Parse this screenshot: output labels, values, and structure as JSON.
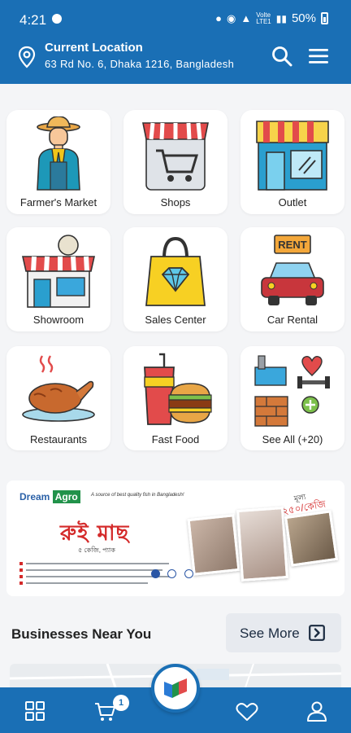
{
  "status": {
    "time": "4:21",
    "network": [
      "Volte",
      "LTE1"
    ],
    "battery": "50%"
  },
  "location": {
    "title": "Current Location",
    "address": "63 Rd No. 6, Dhaka 1216, Bangladesh"
  },
  "header_icons": [
    "search-icon",
    "menu-icon"
  ],
  "categories": [
    {
      "label": "Farmer's Market",
      "icon": "farmer-icon"
    },
    {
      "label": "Shops",
      "icon": "shopping-cart-icon"
    },
    {
      "label": "Outlet",
      "icon": "outlet-store-icon"
    },
    {
      "label": "Showroom",
      "icon": "showroom-icon"
    },
    {
      "label": "Sales Center",
      "icon": "shopping-bag-diamond-icon"
    },
    {
      "label": "Car Rental",
      "icon": "car-rent-icon"
    },
    {
      "label": "Restaurants",
      "icon": "roast-chicken-icon"
    },
    {
      "label": "Fast Food",
      "icon": "burger-drink-icon"
    },
    {
      "label": "See All (+20)",
      "icon": "more-categories-icon"
    }
  ],
  "banner": {
    "brand_a": "Dream",
    "brand_b": "Agro",
    "tagline": "A source of best quality fish in Bangladesh!",
    "title": "রুই মাছ",
    "subtitle": "৫ কেজি, প্যাক",
    "price_label": "মূল্য",
    "price": "৳ ২৫০/কেজি",
    "pages": 3,
    "active_page": 1
  },
  "section": {
    "title": "Businesses Near You",
    "see_more": "See More"
  },
  "bottom_nav": {
    "items": [
      "grid-icon",
      "cart-icon",
      "app-logo-icon",
      "heart-icon",
      "profile-icon"
    ],
    "cart_count": "1"
  },
  "colors": {
    "primary": "#1a6fb5",
    "background": "#f4f5f7",
    "card": "#ffffff",
    "banner_red": "#d42a2a",
    "brand_green": "#21924a"
  }
}
